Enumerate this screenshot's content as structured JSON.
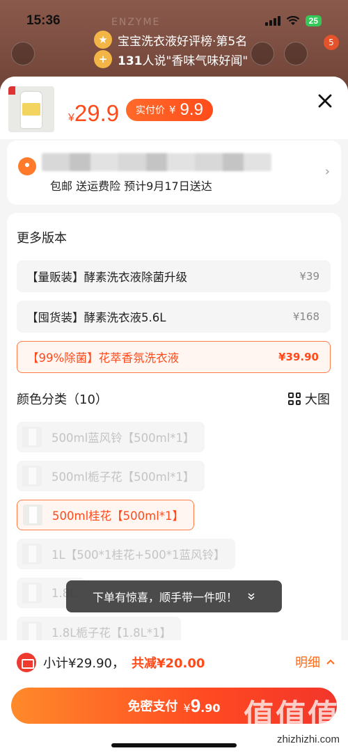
{
  "status_bar": {
    "time": "15:36",
    "battery": "25"
  },
  "background": {
    "brand": "ENZYME",
    "rank_text": "宝宝洗衣液好评榜·第5名",
    "reviews_count": "131",
    "reviews_text": "人说\"香味气味好闻\"",
    "cart_badge": "5"
  },
  "header": {
    "price_currency": "¥",
    "price": "29.9",
    "actual_label": "实付价",
    "actual_currency": "¥",
    "actual_price": "9.9"
  },
  "address": {
    "shipping_info": "包邮 送运费险 预计9月17日送达"
  },
  "versions": {
    "title": "更多版本",
    "items": [
      {
        "name": "【量贩装】酵素洗衣液除菌升级",
        "price": "¥39",
        "selected": false
      },
      {
        "name": "【囤货装】酵素洗衣液5.6L",
        "price": "¥168",
        "selected": false
      },
      {
        "name": "【99%除菌】花萃香氛洗衣液",
        "price": "¥39.90",
        "selected": true
      }
    ]
  },
  "colors": {
    "title": "颜色分类（10）",
    "big_image_label": "大图",
    "items": [
      {
        "label": "500ml蓝风铃【500ml*1】",
        "selected": false
      },
      {
        "label": "500ml栀子花【500ml*1】",
        "selected": false
      },
      {
        "label": "500ml桂花【500ml*1】",
        "selected": true
      },
      {
        "label": "1L【500*1桂花+500*1蓝风铃】",
        "selected": false
      },
      {
        "label": "1.8L",
        "selected": false
      },
      {
        "label": "1.8L栀子花【1.8L*1】",
        "selected": false
      }
    ]
  },
  "toast": {
    "text": "下单有惊喜，顺手带一件呗！"
  },
  "footer": {
    "subtotal": "小计¥29.90，",
    "discount": "共减¥20.00",
    "detail_label": "明细",
    "pay_label": "免密支付",
    "pay_currency": "¥",
    "pay_int": "9",
    "pay_dec": ".90"
  },
  "watermark": {
    "text": "值值值",
    "url": "zhizhizhi.com"
  },
  "theme": {
    "accent": "#ff4a1a",
    "accent_light": "#fff6f2"
  }
}
